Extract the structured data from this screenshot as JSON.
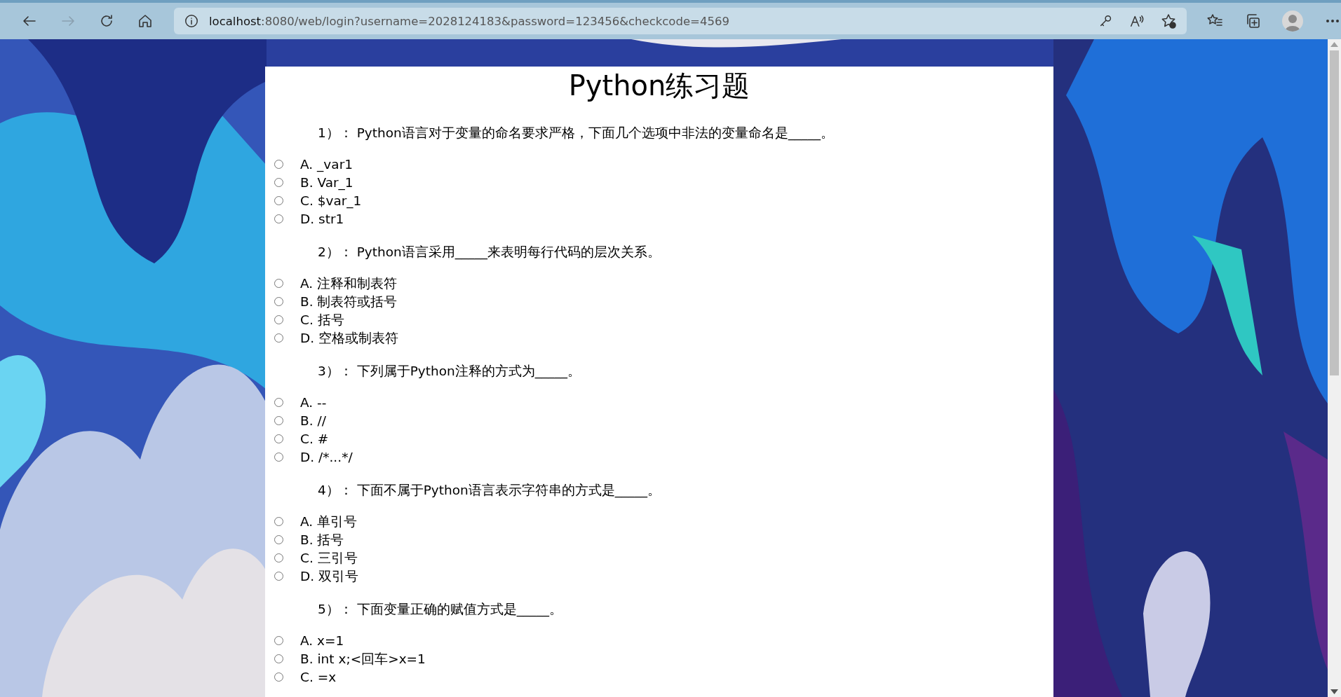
{
  "browser": {
    "url_host": "localhost",
    "url_rest": ":8080/web/login?username=2028124183&password=123456&checkcode=4569",
    "forward_disabled": true
  },
  "page": {
    "kind": "picture",
    "title": "Python练习题",
    "questions": [
      {
        "text": "1）： Python语言对于变量的命名要求严格，下面几个选项中非法的变量命名是_____。",
        "options": [
          {
            "label": "A. _var1",
            "selected": false
          },
          {
            "label": "B. Var_1",
            "selected": false
          },
          {
            "label": "C. $var_1",
            "selected": false
          },
          {
            "label": "D. str1",
            "selected": false
          }
        ]
      },
      {
        "text": "2）： Python语言采用_____来表明每行代码的层次关系。",
        "options": [
          {
            "label": "A. 注释和制表符",
            "selected": false
          },
          {
            "label": "B. 制表符或括号",
            "selected": false
          },
          {
            "label": "C. 括号",
            "selected": false
          },
          {
            "label": "D. 空格或制表符",
            "selected": false
          }
        ]
      },
      {
        "text": "3）： 下列属于Python注释的方式为_____。",
        "options": [
          {
            "label": "A. --",
            "selected": false
          },
          {
            "label": "B. //",
            "selected": false
          },
          {
            "label": "C. #",
            "selected": false
          },
          {
            "label": "D. /*...*/",
            "selected": false
          }
        ]
      },
      {
        "text": "4）： 下面不属于Python语言表示字符串的方式是_____。",
        "options": [
          {
            "label": "A. 单引号",
            "selected": false
          },
          {
            "label": "B. 括号",
            "selected": false
          },
          {
            "label": "C. 三引号",
            "selected": false
          },
          {
            "label": "D. 双引号",
            "selected": false
          }
        ]
      },
      {
        "text": "5）： 下面变量正确的赋值方式是_____。",
        "options": [
          {
            "label": "A. x=1",
            "selected": false
          },
          {
            "label": "B. int x;<回车>x=1",
            "selected": false
          },
          {
            "label": "C. =x",
            "selected": false
          }
        ]
      }
    ]
  }
}
